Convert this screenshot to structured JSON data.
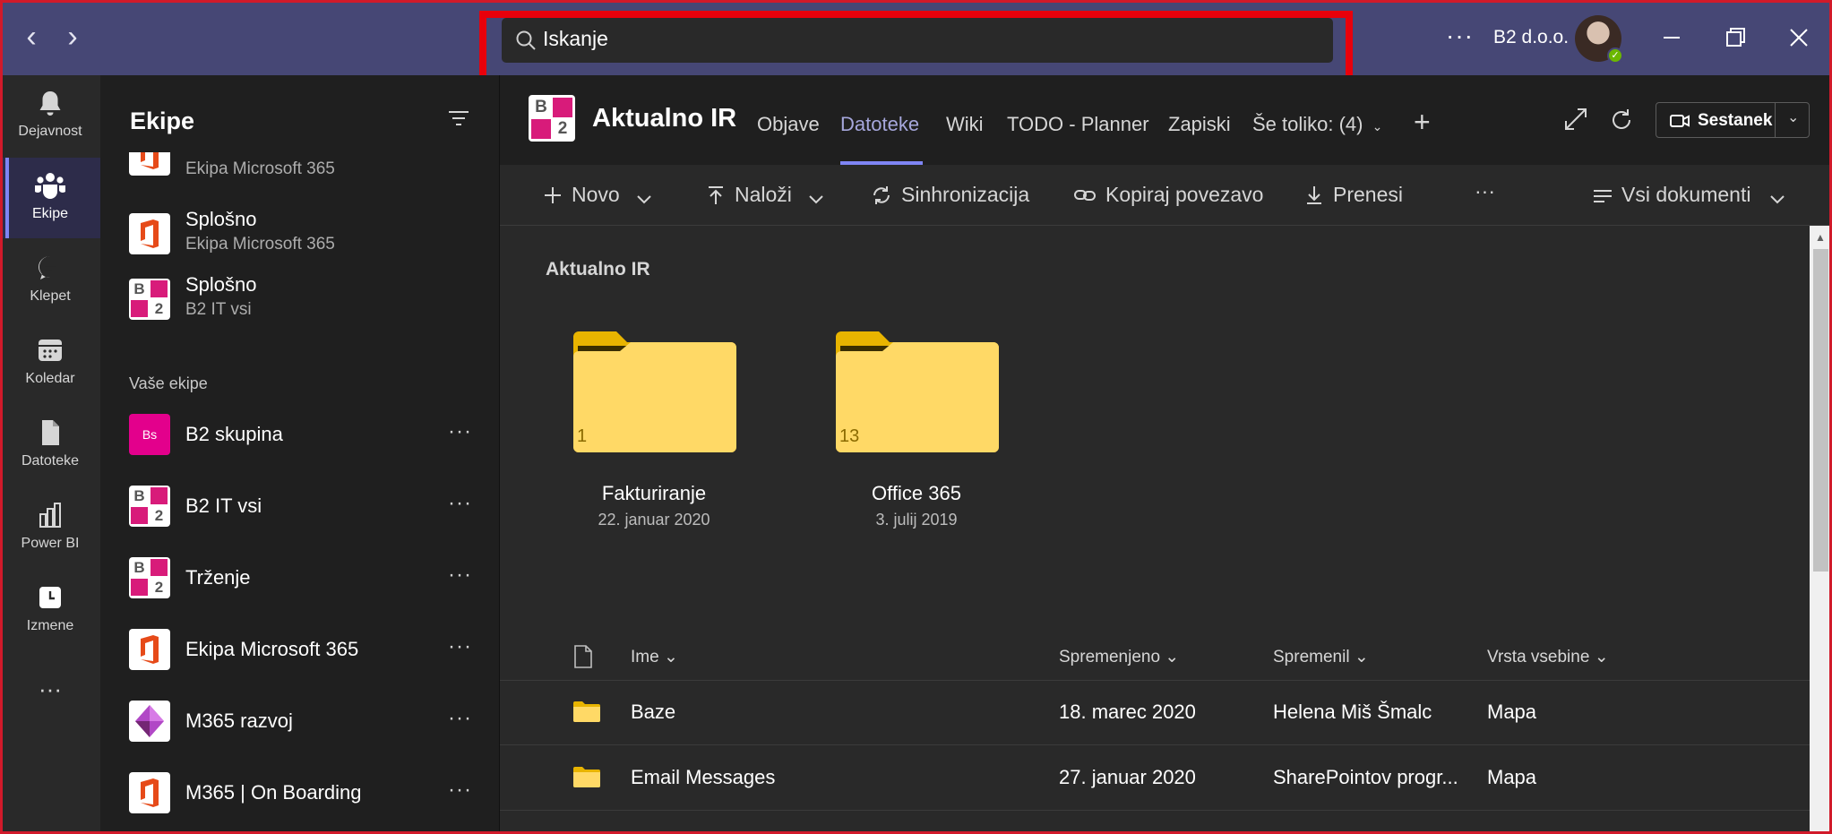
{
  "titlebar": {
    "search_text": "Iskanje",
    "org_name": "B2 d.o.o.",
    "more": "···"
  },
  "rail": {
    "items": [
      {
        "label": "Dejavnost",
        "icon": "bell-icon"
      },
      {
        "label": "Ekipe",
        "icon": "teams-icon"
      },
      {
        "label": "Klepet",
        "icon": "chat-icon"
      },
      {
        "label": "Koledar",
        "icon": "calendar-icon"
      },
      {
        "label": "Datoteke",
        "icon": "file-icon"
      },
      {
        "label": "Power BI",
        "icon": "powerbi-icon"
      },
      {
        "label": "Izmene",
        "icon": "shifts-icon"
      }
    ],
    "more": "···"
  },
  "teams_panel": {
    "title": "Ekipe",
    "pinned": [
      {
        "name": "",
        "sub": "Ekipa Microsoft 365",
        "logo": "o365"
      },
      {
        "name": "Splošno",
        "sub": "Ekipa Microsoft 365",
        "logo": "o365"
      },
      {
        "name": "Splošno",
        "sub": "B2 IT vsi",
        "logo": "b2"
      }
    ],
    "section_label": "Vaše ekipe",
    "teams": [
      {
        "name": "B2 skupina",
        "logo": "bs",
        "logo_text": "Bs"
      },
      {
        "name": "B2 IT vsi",
        "logo": "b2"
      },
      {
        "name": "Trženje",
        "logo": "b2"
      },
      {
        "name": "Ekipa Microsoft 365",
        "logo": "o365"
      },
      {
        "name": "M365 razvoj",
        "logo": "powerapps"
      },
      {
        "name": "M365 | On Boarding",
        "logo": "o365"
      }
    ],
    "row_more": "···"
  },
  "channel": {
    "title": "Aktualno IR",
    "tabs": [
      "Objave",
      "Datoteke",
      "Wiki",
      "TODO - Planner",
      "Zapiski",
      "Še toliko: (4)"
    ],
    "active_tab": "Datoteke",
    "meet_label": "Sestanek"
  },
  "commands": {
    "new": "Novo",
    "upload": "Naloži",
    "sync": "Sinhronizacija",
    "copy_link": "Kopiraj povezavo",
    "download": "Prenesi",
    "more": "···",
    "view": "Vsi dokumenti"
  },
  "documents": {
    "breadcrumb": "Aktualno IR",
    "folders": [
      {
        "name": "Fakturiranje",
        "date": "22. januar 2020",
        "count": "1"
      },
      {
        "name": "Office 365",
        "date": "3. julij 2019",
        "count": "13"
      }
    ],
    "columns": [
      "Ime",
      "Spremenjeno",
      "Spremenil",
      "Vrsta vsebine"
    ],
    "rows": [
      {
        "name": "Baze",
        "modified": "18. marec 2020",
        "modified_by": "Helena Miš Šmalc",
        "type": "Mapa"
      },
      {
        "name": "Email Messages",
        "modified": "27. januar 2020",
        "modified_by": "SharePointov progr...",
        "type": "Mapa"
      }
    ]
  },
  "colors": {
    "titlebar": "#464775",
    "accent": "#7f85f5",
    "highlight": "#e8000b",
    "folder": "#ffd966"
  }
}
